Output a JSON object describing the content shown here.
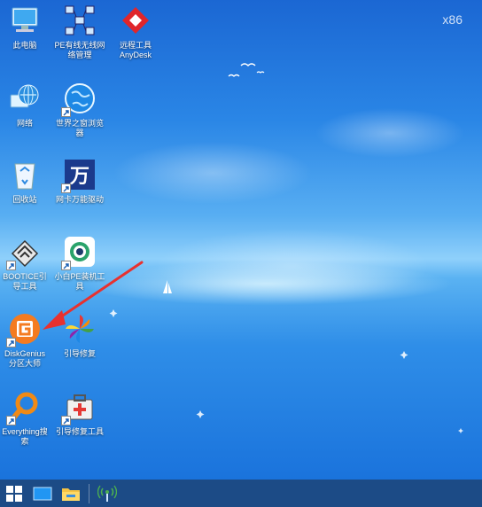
{
  "desktop": {
    "arch_label": "x86",
    "icons": [
      {
        "label": "此电脑",
        "icon": "computer-icon"
      },
      {
        "label": "PE有线无线网\n络管理",
        "icon": "network-manager-icon"
      },
      {
        "label": "远程工具\nAnyDesk",
        "icon": "anydesk-icon"
      },
      {
        "label": "网络",
        "icon": "network-globe-icon"
      },
      {
        "label": "世界之窗浏览\n器",
        "icon": "browser-globe-icon"
      },
      {
        "label": "回收站",
        "icon": "recycle-bin-icon"
      },
      {
        "label": "网卡万能驱动",
        "icon": "wan-driver-icon"
      },
      {
        "label": "BOOTICE引\n导工具",
        "icon": "bootice-icon"
      },
      {
        "label": "小白PE装机工\n具",
        "icon": "xiaobai-pe-icon"
      },
      {
        "label": "DiskGenius\n分区大师",
        "icon": "diskgenius-icon"
      },
      {
        "label": "引导修复",
        "icon": "boot-repair-icon"
      },
      {
        "label": "Everything搜\n索",
        "icon": "everything-search-icon"
      },
      {
        "label": "引导修复工具",
        "icon": "boot-repair-tool-icon"
      }
    ]
  },
  "colors": {
    "arrow": "#e8312f",
    "taskbar": "#1c4b86"
  },
  "taskbar": {
    "items": [
      "start-icon",
      "desktop-icon",
      "file-explorer-icon",
      "network-signal-icon"
    ]
  }
}
